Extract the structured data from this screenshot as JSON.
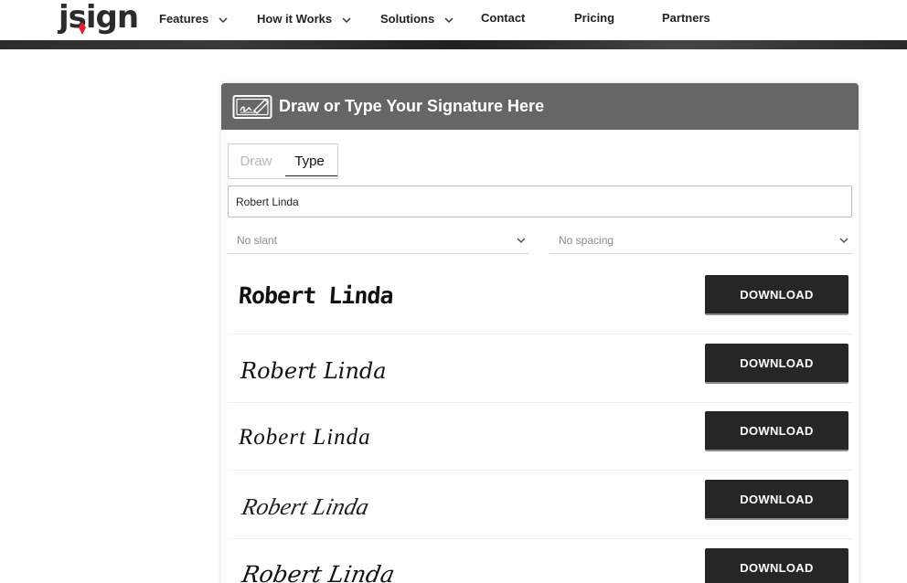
{
  "header": {
    "logo_text": "jsign",
    "nav": [
      {
        "label": "Features",
        "has_dropdown": true
      },
      {
        "label": "How it Works",
        "has_dropdown": true
      },
      {
        "label": "Solutions",
        "has_dropdown": true
      },
      {
        "label": "Contact",
        "has_dropdown": false
      },
      {
        "label": "Pricing",
        "has_dropdown": false
      },
      {
        "label": "Partners",
        "has_dropdown": false
      }
    ]
  },
  "card": {
    "title": "Draw or Type Your Signature Here",
    "icon": "signature-pad-icon",
    "tabs": [
      {
        "label": "Draw",
        "active": false
      },
      {
        "label": "Type",
        "active": true
      }
    ],
    "name_value": "Robert Linda",
    "slant_select": "No slant",
    "spacing_select": "No spacing",
    "signatures": [
      {
        "text": "Robert Linda",
        "button": "DOWNLOAD"
      },
      {
        "text": "Robert Linda",
        "button": "DOWNLOAD"
      },
      {
        "text": "Robert Linda",
        "button": "DOWNLOAD"
      },
      {
        "text": "Robert Linda",
        "button": "DOWNLOAD"
      },
      {
        "text": "Robert Linda",
        "button": "DOWNLOAD"
      }
    ]
  },
  "colors": {
    "card_header": "#666666",
    "button": "#262626",
    "logo_accent": "#e0202e"
  }
}
